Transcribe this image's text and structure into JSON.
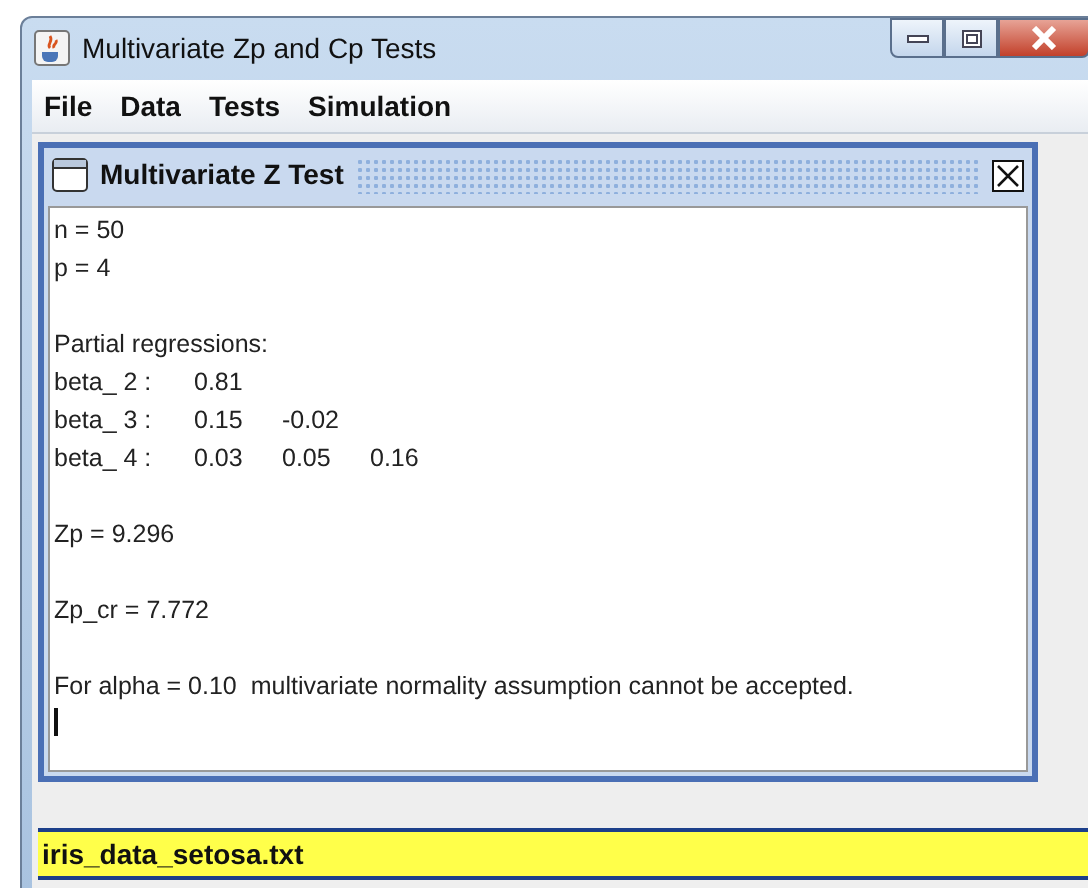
{
  "window": {
    "title": "Multivariate Zp and Cp Tests"
  },
  "menu": [
    "File",
    "Data",
    "Tests",
    "Simulation"
  ],
  "internal_frame": {
    "title": "Multivariate Z Test",
    "paragraphs": [
      [
        {
          "kind": "text",
          "text": "n = 50"
        },
        {
          "kind": "text",
          "text": "p = 4"
        }
      ],
      [
        {
          "kind": "text",
          "text": "Partial regressions:"
        },
        {
          "kind": "row",
          "label": "beta_ 2 :",
          "values": [
            "0.81"
          ]
        },
        {
          "kind": "row",
          "label": "beta_ 3 :",
          "values": [
            "0.15",
            "-0.02"
          ]
        },
        {
          "kind": "row",
          "label": "beta_ 4 :",
          "values": [
            "0.03",
            "0.05",
            "0.16"
          ]
        }
      ],
      [
        {
          "kind": "text",
          "text": "Zp = 9.296"
        }
      ],
      [
        {
          "kind": "text",
          "text": "Zp_cr = 7.772"
        }
      ],
      [
        {
          "kind": "text",
          "text": "For alpha = 0.10  multivariate normality assumption cannot be accepted."
        }
      ]
    ]
  },
  "status_bar": {
    "text": "iris_data_setosa.txt"
  }
}
